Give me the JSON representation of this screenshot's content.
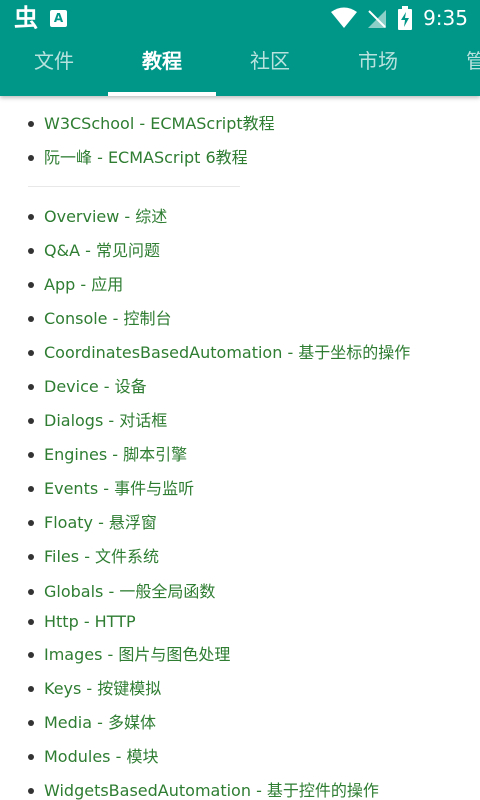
{
  "statusbar": {
    "app_glyph": "虫",
    "badge": "A",
    "time": "9:35"
  },
  "tabs": [
    {
      "label": "文件",
      "active": false
    },
    {
      "label": "教程",
      "active": true
    },
    {
      "label": "社区",
      "active": false
    },
    {
      "label": "市场",
      "active": false
    },
    {
      "label": "管",
      "active": false
    }
  ],
  "top_links": [
    "W3CSchool - ECMAScript教程",
    "阮一峰 - ECMAScript 6教程"
  ],
  "doc_links": [
    "Overview - 综述",
    "Q&A - 常见问题",
    "App - 应用",
    "Console - 控制台",
    "CoordinatesBasedAutomation - 基于坐标的操作",
    "Device - 设备",
    "Dialogs - 对话框",
    "Engines - 脚本引擎",
    "Events - 事件与监听",
    "Floaty - 悬浮窗",
    "Files - 文件系统",
    "Globals - 一般全局函数",
    "Http - HTTP",
    "Images - 图片与图色处理",
    "Keys - 按键模拟",
    "Media - 多媒体",
    "Modules - 模块",
    "WidgetsBasedAutomation - 基于控件的操作"
  ],
  "colors": {
    "primary": "#009688",
    "link": "#2e7d32"
  }
}
